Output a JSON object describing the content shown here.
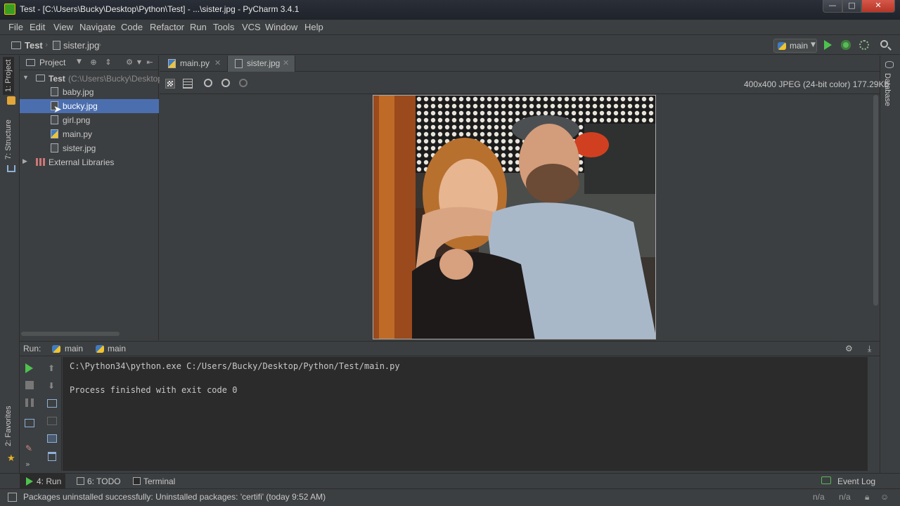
{
  "window": {
    "title": "Test - [C:\\Users\\Bucky\\Desktop\\Python\\Test] - ...\\sister.jpg - PyCharm 3.4.1",
    "minimize": "—",
    "maximize": "□",
    "close": "✕"
  },
  "menu": [
    "File",
    "Edit",
    "View",
    "Navigate",
    "Code",
    "Refactor",
    "Run",
    "Tools",
    "VCS",
    "Window",
    "Help"
  ],
  "nav": {
    "project": "Test",
    "file": "sister.jpg",
    "run_config": "main"
  },
  "left_tabs": {
    "project": "1: Project",
    "structure": "7: Structure",
    "favorites": "2: Favorites"
  },
  "right_tabs": {
    "database": "Database"
  },
  "project_panel": {
    "header": "Project",
    "root_name": "Test",
    "root_path": "(C:\\Users\\Bucky\\Desktop",
    "files": [
      "baby.jpg",
      "bucky.jpg",
      "girl.png",
      "main.py",
      "sister.jpg"
    ],
    "selected": "bucky.jpg",
    "external": "External Libraries"
  },
  "editor": {
    "tabs": [
      "main.py",
      "sister.jpg"
    ],
    "active_tab": "sister.jpg",
    "image_info": "400x400 JPEG (24-bit color) 177.29Kb"
  },
  "run": {
    "label": "Run:",
    "tabs": [
      "main",
      "main"
    ],
    "console": [
      "C:\\Python34\\python.exe C:/Users/Bucky/Desktop/Python/Test/main.py",
      "",
      "Process finished with exit code 0"
    ]
  },
  "bottom_bar": {
    "run": "4: Run",
    "todo": "6: TODO",
    "terminal": "Terminal",
    "event_log": "Event Log"
  },
  "status": {
    "message": "Packages uninstalled successfully: Uninstalled packages: 'certifi' (today 9:52 AM)",
    "pos1": "n/a",
    "pos2": "n/a"
  },
  "colors": {
    "selection": "#4b6eaf",
    "background": "#3c3f41",
    "console_bg": "#2b2b2b",
    "run_green": "#4ec24e"
  }
}
